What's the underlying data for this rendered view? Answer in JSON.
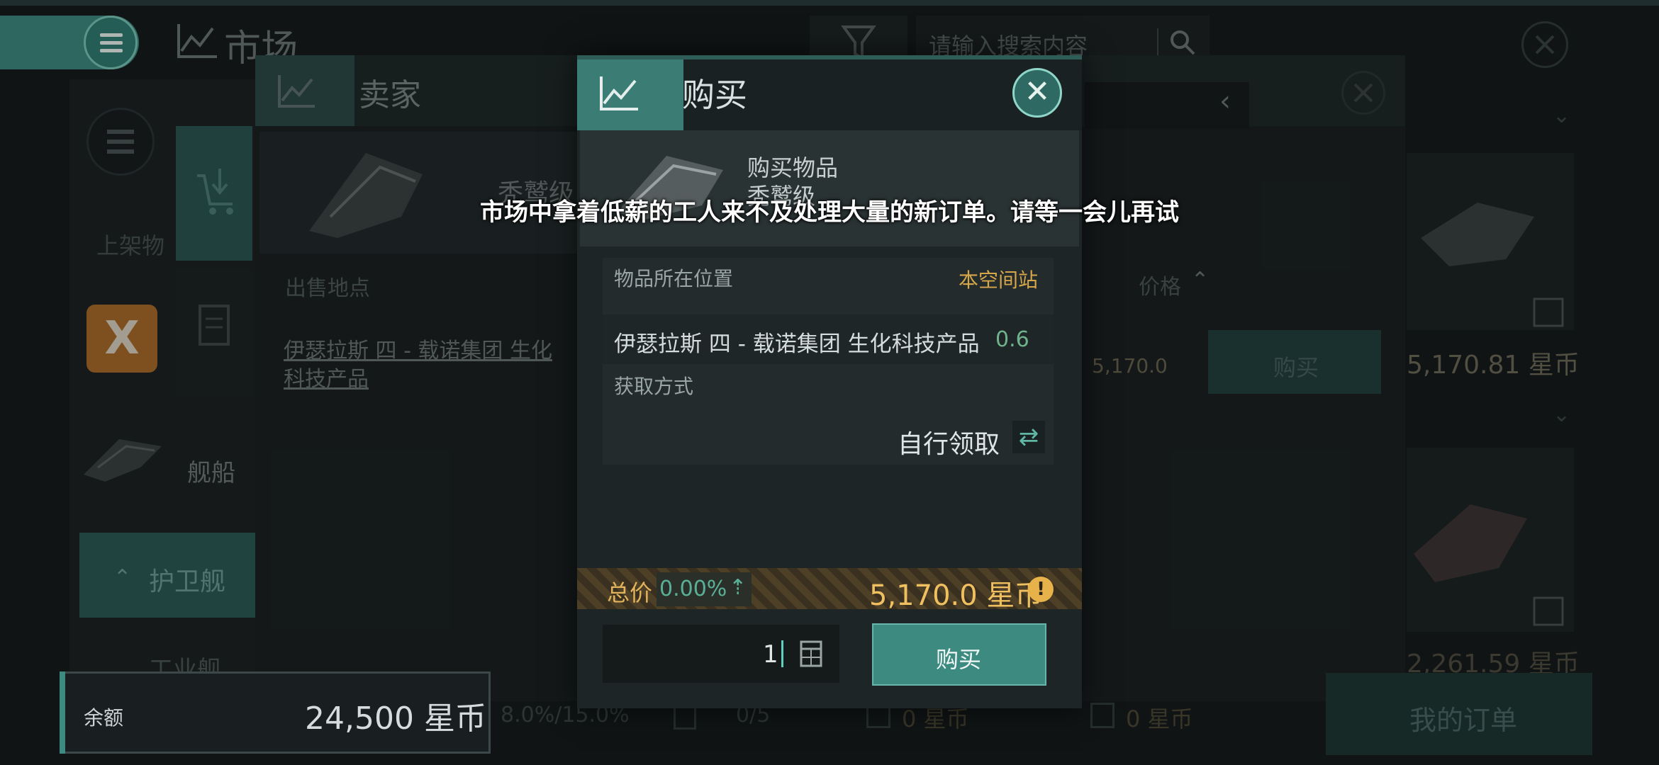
{
  "app": {
    "title": "市场",
    "search_placeholder": "请输入搜索内容"
  },
  "left_panel": {
    "listed_label": "上架物",
    "ships_label": "舰船",
    "frigate_label": "护卫舰",
    "industrial_label": "工业舰",
    "item_x_symbol": "X"
  },
  "seller_window": {
    "title": "卖家",
    "ship_name": "秃鹫级",
    "col_location": "出售地点",
    "location": "伊瑟拉斯 四 - 载诺集团 生化科技产品",
    "col_price": "价格",
    "row_price": "5,170.0",
    "buy_label": "购买"
  },
  "right_column": {
    "price1": "5,170.81 星币",
    "price2": "2,261.59 星币",
    "my_orders": "我的订单"
  },
  "bottom_bar": {
    "balance_label": "余额",
    "balance_value": "24,500 星币",
    "tax_rate": "8.0%/15.0%",
    "order_count": "0/5",
    "fee1": "0 星币",
    "fee2": "0 星币"
  },
  "buy_dialog": {
    "title": "购买",
    "close_symbol": "✕",
    "item_label": "购买物品",
    "item_name": "秃鹫级",
    "location_label": "物品所在位置",
    "location_station": "本空间站",
    "location_value": "伊瑟拉斯 四 - 载诺集团 生化科技产品",
    "location_security": "0.6",
    "acquire_label": "获取方式",
    "acquire_value": "自行领取",
    "total_label": "总价",
    "total_pct": "0.00%",
    "total_price": "5,170.0 星币",
    "warn_symbol": "!",
    "quantity": "1",
    "buy_button": "购买"
  },
  "toast": {
    "message": "市场中拿着低薪的工人来不及处理大量的新订单。请等一会儿再试"
  },
  "colors": {
    "accent_teal": "#3d8a80",
    "gold": "#f0c060",
    "background": "#161b1c"
  },
  "icons": [
    "menu-icon",
    "market-chart-icon",
    "filter-icon",
    "search-icon",
    "close-icon",
    "list-icon",
    "upload-cart-icon",
    "orders-clipboard-icon",
    "swap-icon",
    "calculator-icon",
    "warning-icon",
    "chevron-left-icon",
    "chevron-down-icon",
    "up-arrow-icon"
  ]
}
